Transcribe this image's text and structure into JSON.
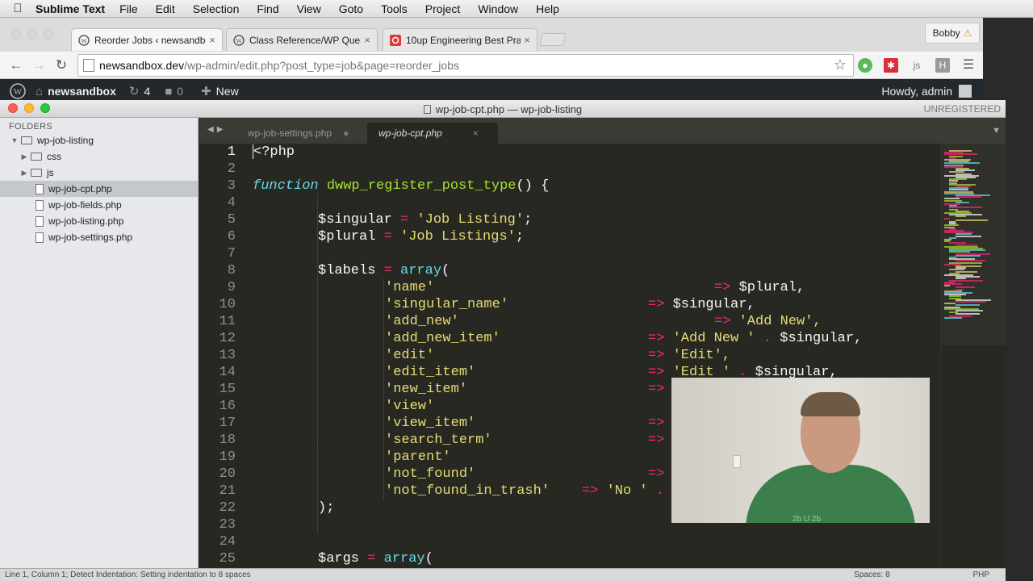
{
  "menubar": {
    "app": "Sublime Text",
    "items": [
      "File",
      "Edit",
      "Selection",
      "Find",
      "View",
      "Goto",
      "Tools",
      "Project",
      "Window",
      "Help"
    ]
  },
  "browser": {
    "tabs": [
      {
        "title": "Reorder Jobs ‹ newsandbo",
        "icon": "wordpress-icon",
        "active": true
      },
      {
        "title": "Class Reference/WP Query",
        "icon": "wordpress-icon",
        "active": false
      },
      {
        "title": "10up Engineering Best Pra",
        "icon": "10up-icon",
        "active": false
      }
    ],
    "close_glyph": "×",
    "profile": "Bobby",
    "url_host": "newsandbox.dev",
    "url_path": "/wp-admin/edit.php?post_type=job&page=reorder_jobs"
  },
  "wpbar": {
    "site": "newsandbox",
    "updates": "4",
    "comments": "0",
    "new": "New",
    "howdy": "Howdy, admin"
  },
  "sublime": {
    "window_title": "wp-job-cpt.php — wp-job-listing",
    "unregistered": "UNREGISTERED",
    "folders_header": "FOLDERS",
    "tree": [
      {
        "label": "wp-job-listing",
        "kind": "folder-open",
        "depth": 0
      },
      {
        "label": "css",
        "kind": "folder",
        "depth": 1
      },
      {
        "label": "js",
        "kind": "folder",
        "depth": 1
      },
      {
        "label": "wp-job-cpt.php",
        "kind": "file",
        "depth": 1,
        "selected": true
      },
      {
        "label": "wp-job-fields.php",
        "kind": "file",
        "depth": 1
      },
      {
        "label": "wp-job-listing.php",
        "kind": "file",
        "depth": 1
      },
      {
        "label": "wp-job-settings.php",
        "kind": "file",
        "depth": 1
      }
    ],
    "editor_tabs": [
      {
        "label": "wp-job-settings.php",
        "dirty": true
      },
      {
        "label": "wp-job-cpt.php",
        "active": true
      }
    ],
    "line_numbers": [
      "1",
      "2",
      "3",
      "4",
      "5",
      "6",
      "7",
      "8",
      "9",
      "10",
      "11",
      "12",
      "13",
      "14",
      "15",
      "16",
      "17",
      "18",
      "19",
      "20",
      "21",
      "22",
      "23",
      "24",
      "25"
    ],
    "code": {
      "l1": "<?php",
      "l3_kw": "function",
      "l3_name": "dwwp_register_post_type",
      "l3_rest": "() {",
      "l5_var": "$singular",
      "l5_op": "=",
      "l5_str": "'Job Listing'",
      "l5_end": ";",
      "l6_var": "$plural",
      "l6_str": "'Job Listings'",
      "l8_var": "$labels",
      "l8_fn": "array",
      "l8_rest": "(",
      "arrow": "=>",
      "dot": ".",
      "keys": [
        "'name'",
        "'singular_name'",
        "'add_new'",
        "'add_new_item'",
        "'edit'",
        "'edit_item'",
        "'new_item'",
        "'view'",
        "'view_item'",
        "'search_term'",
        "'parent'",
        "'not_found'",
        "'not_found_in_trash'"
      ],
      "v9": "$plural,",
      "v10": "$singular,",
      "v11": "'Add New',",
      "v12_str": "'Add New '",
      "v12_var": "$singular,",
      "v13": "'Edit',",
      "v14_str": "'Edit '",
      "v14_var": "$singular,",
      "v21_str": "'No '",
      "l22": ");",
      "l25_var": "$args",
      "l25_fn": "array",
      "l25_rest": "("
    },
    "status_left": "Line 1, Column 1; Detect Indentation: Setting indentation to 8 spaces",
    "status_spaces": "Spaces: 8",
    "status_syntax": "PHP"
  },
  "webcam": {
    "shirt_text": "2b U 2b"
  }
}
